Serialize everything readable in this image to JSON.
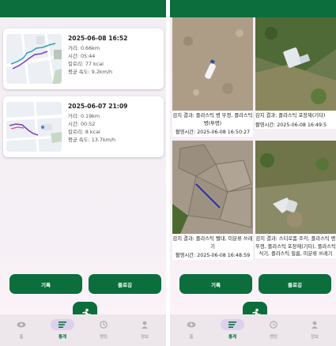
{
  "records": [
    {
      "date": "2025-06-08 16:52",
      "distance": "거리: 0.66km",
      "time": "시간: 05:44",
      "calories": "칼로리: 77 kcal",
      "speed": "평균 속도: 9.2km/h"
    },
    {
      "date": "2025-06-07 21:09",
      "distance": "거리: 0.19km",
      "time": "시간: 00:52",
      "calories": "칼로리: 8 kcal",
      "speed": "평균 속도: 13.7km/h"
    }
  ],
  "detections": [
    {
      "result": "감지 결과: 플라스틱 병 뚜껑, 플라스틱병(투명)",
      "taken": "촬영시간: 2025-06-08 16:50:27"
    },
    {
      "result": "감지 결과: 플라스틱 포장재(기타)",
      "taken": "촬영시간: 2025-06-08 16:49:5"
    },
    {
      "result": "감지 결과: 플라스틱 빨대, 미분류 쓰레기",
      "taken": "촬영시간: 2025-06-08 16:48:59"
    },
    {
      "result": "감지 결과: 스티로폼 조각, 플라스틱 병 뚜껑, 플라스틱 포장재(기타), 플라스틱 식기, 플라스틱 필름, 미분류 쓰레기",
      "taken": ""
    }
  ],
  "buttons": {
    "record": "기록",
    "plogging": "플로깅"
  },
  "nav": {
    "home": "홈",
    "stats": "통계",
    "ranking": "랭킹",
    "info": "정보"
  },
  "colors": {
    "primary": "#0b6e3c",
    "nav_active_pill": "#dcd0ec"
  },
  "icons": {
    "fab": "running-person-icon",
    "home": "eye-icon",
    "stats": "bar-list-icon",
    "ranking": "clock-icon",
    "info": "person-icon"
  }
}
